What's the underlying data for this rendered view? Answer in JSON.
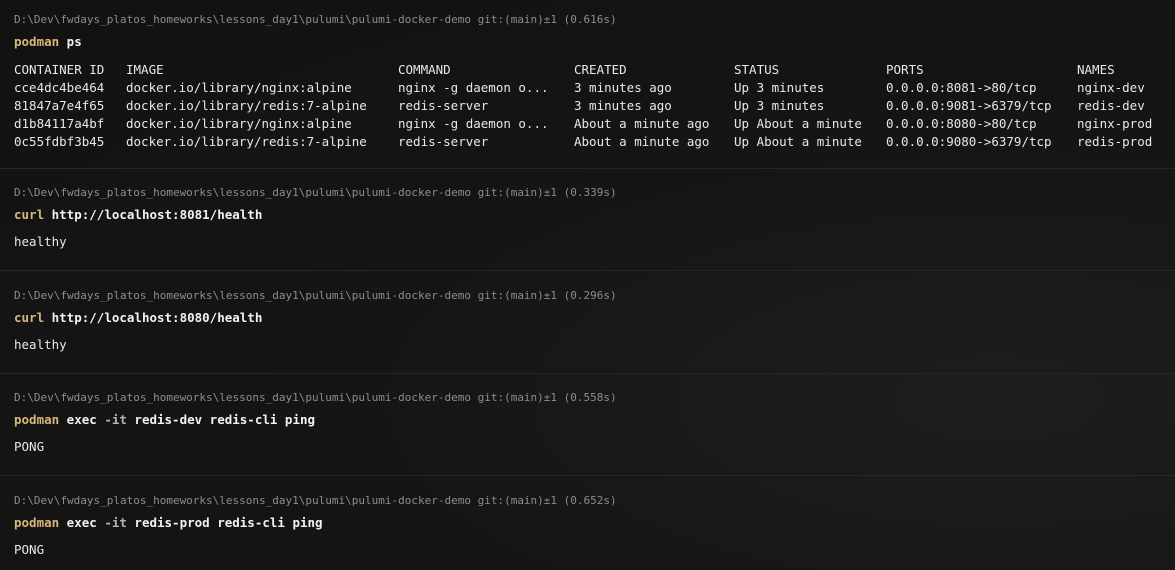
{
  "blocks": [
    {
      "prompt": "D:\\Dev\\fwdays_platos_homeworks\\lessons_day1\\pulumi\\pulumi-docker-demo git:(main)±1 (0.616s)",
      "program": "podman",
      "args": " ps",
      "table": {
        "headers": [
          "CONTAINER ID",
          "IMAGE",
          "COMMAND",
          "CREATED",
          "STATUS",
          "PORTS",
          "NAMES"
        ],
        "rows": [
          [
            "cce4dc4be464",
            "docker.io/library/nginx:alpine",
            "nginx -g daemon o...",
            "3 minutes ago",
            "Up 3 minutes",
            "0.0.0.0:8081->80/tcp",
            "nginx-dev"
          ],
          [
            "81847a7e4f65",
            "docker.io/library/redis:7-alpine",
            "redis-server",
            "3 minutes ago",
            "Up 3 minutes",
            "0.0.0.0:9081->6379/tcp",
            "redis-dev"
          ],
          [
            "d1b84117a4bf",
            "docker.io/library/nginx:alpine",
            "nginx -g daemon o...",
            "About a minute ago",
            "Up About a minute",
            "0.0.0.0:8080->80/tcp",
            "nginx-prod"
          ],
          [
            "0c55fdbf3b45",
            "docker.io/library/redis:7-alpine",
            "redis-server",
            "About a minute ago",
            "Up About a minute",
            "0.0.0.0:9080->6379/tcp",
            "redis-prod"
          ]
        ]
      }
    },
    {
      "prompt": "D:\\Dev\\fwdays_platos_homeworks\\lessons_day1\\pulumi\\pulumi-docker-demo git:(main)±1 (0.339s)",
      "program": "curl",
      "args": " http://localhost:8081/health",
      "output": "healthy"
    },
    {
      "prompt": "D:\\Dev\\fwdays_platos_homeworks\\lessons_day1\\pulumi\\pulumi-docker-demo git:(main)±1 (0.296s)",
      "program": "curl",
      "args": " http://localhost:8080/health",
      "output": "healthy"
    },
    {
      "prompt": "D:\\Dev\\fwdays_platos_homeworks\\lessons_day1\\pulumi\\pulumi-docker-demo git:(main)±1 (0.558s)",
      "program": "podman",
      "args_pre": " exec ",
      "flag": "-it",
      "args": " redis-dev redis-cli ping",
      "output": "PONG"
    },
    {
      "prompt": "D:\\Dev\\fwdays_platos_homeworks\\lessons_day1\\pulumi\\pulumi-docker-demo git:(main)±1 (0.652s)",
      "program": "podman",
      "args_pre": " exec ",
      "flag": "-it",
      "args": " redis-prod redis-cli ping",
      "output": "PONG"
    }
  ],
  "colors": {
    "background": "#161616",
    "prompt": "#8d8d8d",
    "program": "#d9b77a",
    "text": "#e8e8e8"
  }
}
